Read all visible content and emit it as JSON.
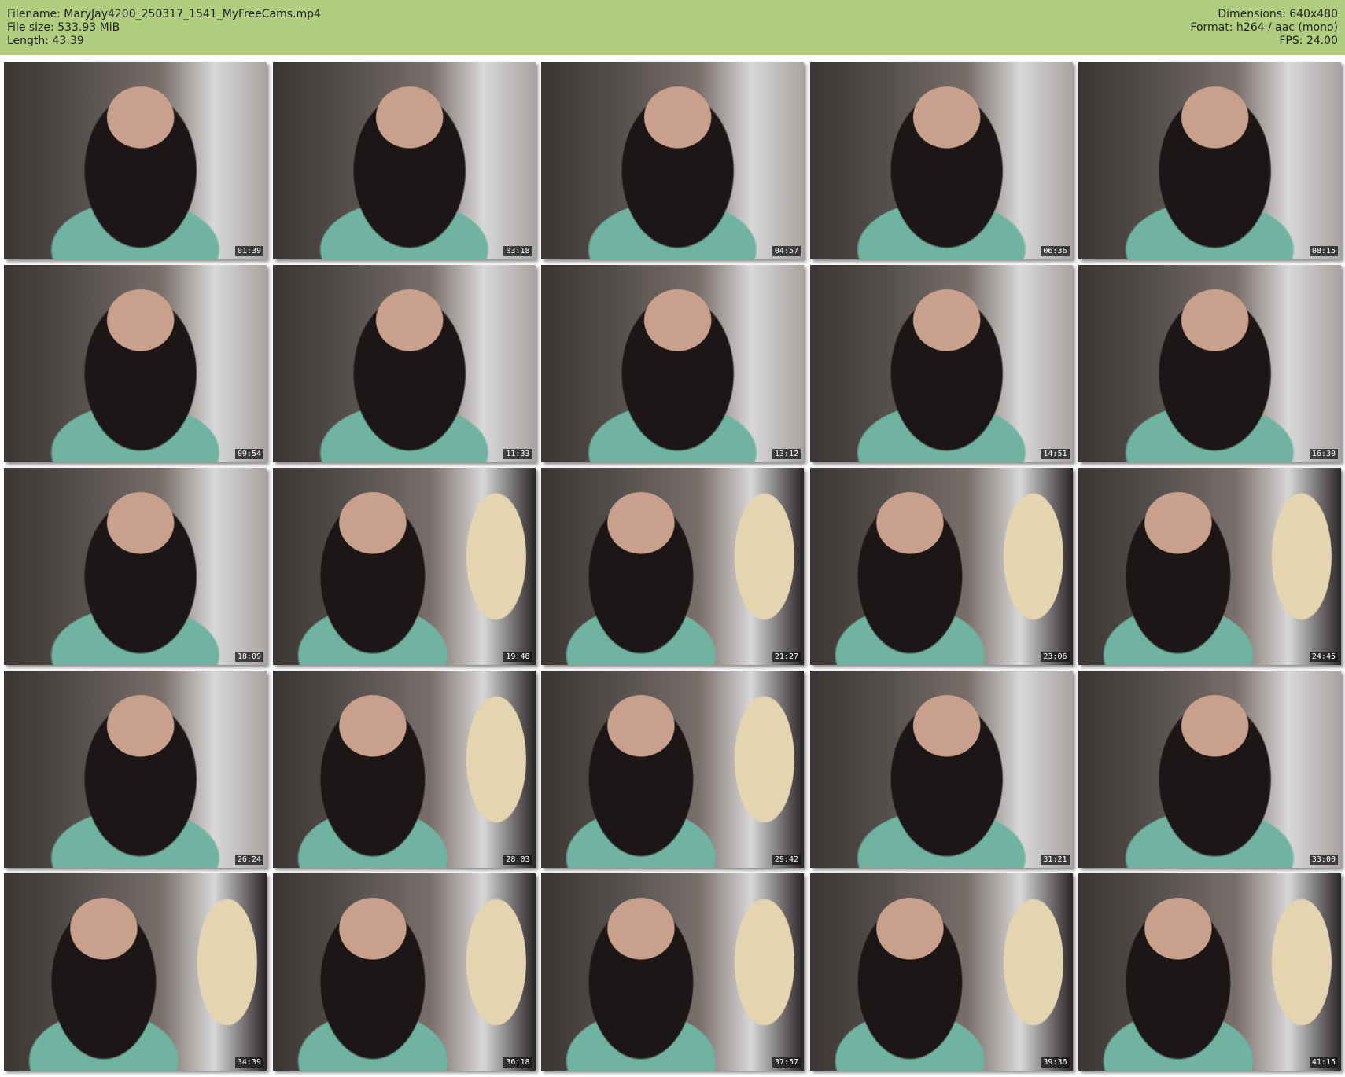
{
  "header": {
    "filename": "Filename: MaryJay4200_250317_1541_MyFreeCams.mp4",
    "filesize": "File size: 533.93 MiB",
    "length": "Length: 43:39",
    "dimensions": "Dimensions: 640x480",
    "format": "Format: h264 / aac (mono)",
    "fps": "FPS: 24.00"
  },
  "thumbnails": [
    {
      "time": "01:39"
    },
    {
      "time": "03:18"
    },
    {
      "time": "04:57"
    },
    {
      "time": "06:36"
    },
    {
      "time": "08:15"
    },
    {
      "time": "09:54"
    },
    {
      "time": "11:33"
    },
    {
      "time": "13:12"
    },
    {
      "time": "14:51"
    },
    {
      "time": "16:30"
    },
    {
      "time": "18:09"
    },
    {
      "time": "19:48",
      "alt": true
    },
    {
      "time": "21:27",
      "alt": true
    },
    {
      "time": "23:06",
      "alt": true
    },
    {
      "time": "24:45",
      "alt": true
    },
    {
      "time": "26:24"
    },
    {
      "time": "28:03",
      "alt": true
    },
    {
      "time": "29:42",
      "alt": true
    },
    {
      "time": "31:21"
    },
    {
      "time": "33:00"
    },
    {
      "time": "34:39",
      "alt": true
    },
    {
      "time": "36:18",
      "alt": true
    },
    {
      "time": "37:57",
      "alt": true
    },
    {
      "time": "39:36",
      "alt": true
    },
    {
      "time": "41:15",
      "alt": true
    }
  ]
}
